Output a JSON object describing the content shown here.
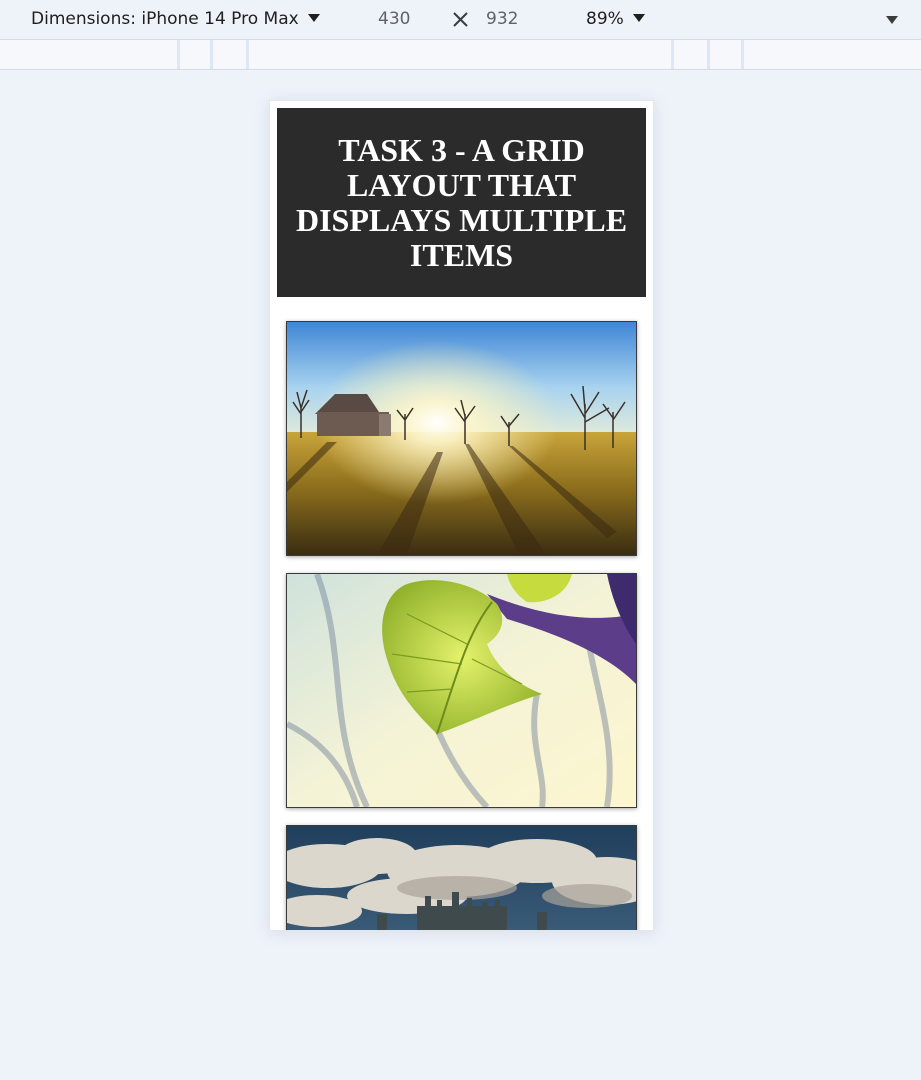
{
  "toolbar": {
    "dimensions_label": "Dimensions: iPhone 14 Pro Max",
    "width_value": "430",
    "height_value": "932",
    "zoom_label": "89%"
  },
  "page": {
    "title": "TASK 3 - A GRID LAYOUT THAT DISPLAYS MULTIPLE ITEMS"
  },
  "grid": {
    "items": [
      {
        "name": "sunset-barn-field-image"
      },
      {
        "name": "green-leaf-closeup-image"
      },
      {
        "name": "castle-cloudy-sky-image"
      }
    ]
  },
  "icons": {
    "dropdown": "caret-down-icon",
    "swap": "times-icon",
    "more": "caret-down-icon"
  }
}
